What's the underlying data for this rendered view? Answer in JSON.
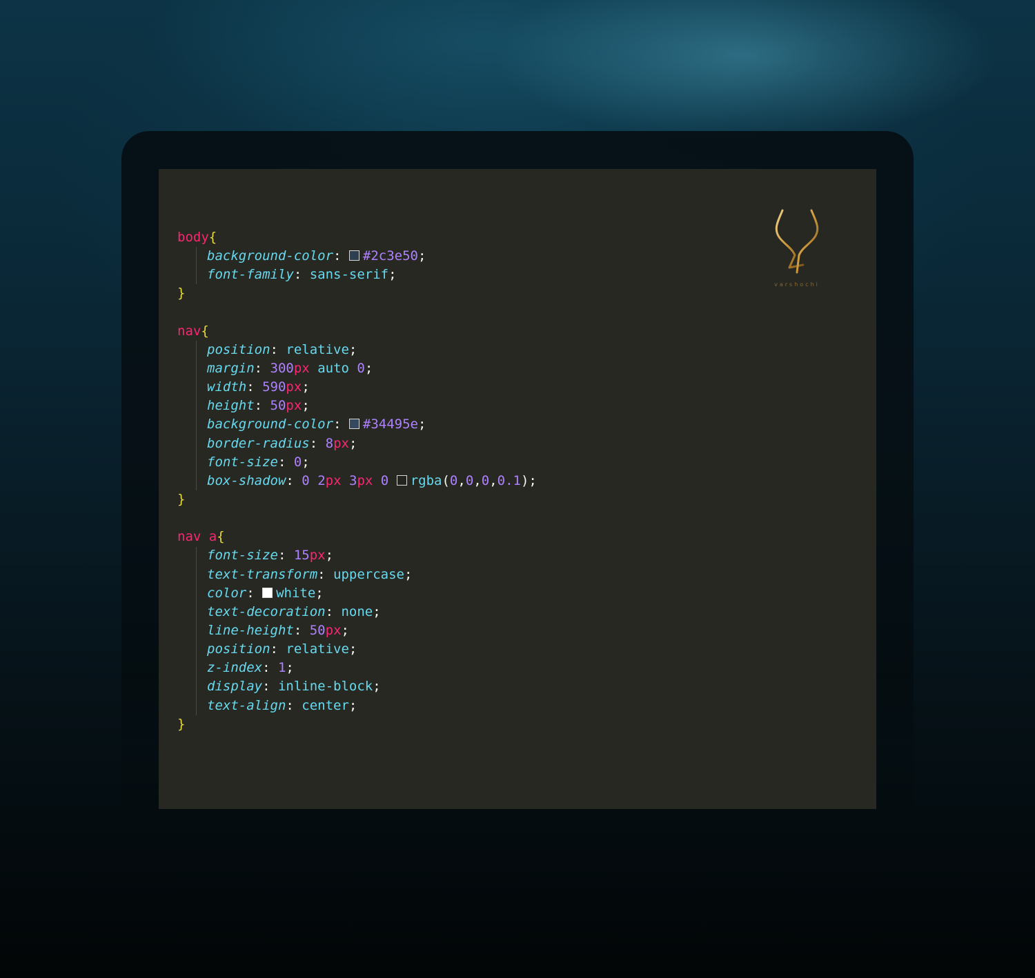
{
  "brand": {
    "name": "varshochi",
    "gold": "#c9963a"
  },
  "code": {
    "rules": [
      {
        "selector": [
          "body"
        ],
        "decls": [
          {
            "prop": "background-color",
            "value": [
              {
                "t": "sw",
                "color": "#2c3e50"
              },
              {
                "t": "hex",
                "v": "#2c3e50"
              }
            ]
          },
          {
            "prop": "font-family",
            "value": [
              {
                "t": "val",
                "v": "sans-serif"
              }
            ]
          }
        ]
      },
      {
        "selector": [
          "nav"
        ],
        "decls": [
          {
            "prop": "position",
            "value": [
              {
                "t": "val",
                "v": "relative"
              }
            ]
          },
          {
            "prop": "margin",
            "value": [
              {
                "t": "num",
                "v": "300"
              },
              {
                "t": "unit",
                "v": "px"
              },
              {
                "t": "sp"
              },
              {
                "t": "val",
                "v": "auto"
              },
              {
                "t": "sp"
              },
              {
                "t": "num",
                "v": "0"
              }
            ]
          },
          {
            "prop": "width",
            "value": [
              {
                "t": "num",
                "v": "590"
              },
              {
                "t": "unit",
                "v": "px"
              }
            ]
          },
          {
            "prop": "height",
            "value": [
              {
                "t": "num",
                "v": "50"
              },
              {
                "t": "unit",
                "v": "px"
              }
            ]
          },
          {
            "prop": "background-color",
            "value": [
              {
                "t": "sw",
                "color": "#34495e"
              },
              {
                "t": "hex",
                "v": "#34495e"
              }
            ]
          },
          {
            "prop": "border-radius",
            "value": [
              {
                "t": "num",
                "v": "8"
              },
              {
                "t": "unit",
                "v": "px"
              }
            ]
          },
          {
            "prop": "font-size",
            "value": [
              {
                "t": "num",
                "v": "0"
              }
            ]
          },
          {
            "prop": "box-shadow",
            "value": [
              {
                "t": "num",
                "v": "0"
              },
              {
                "t": "sp"
              },
              {
                "t": "num",
                "v": "2"
              },
              {
                "t": "unit",
                "v": "px"
              },
              {
                "t": "sp"
              },
              {
                "t": "num",
                "v": "3"
              },
              {
                "t": "unit",
                "v": "px"
              },
              {
                "t": "sp"
              },
              {
                "t": "num",
                "v": "0"
              },
              {
                "t": "sp"
              },
              {
                "t": "sw",
                "color": "rgba(0,0,0,0.1)"
              },
              {
                "t": "val",
                "v": "rgba"
              },
              {
                "t": "punc",
                "v": "("
              },
              {
                "t": "num",
                "v": "0"
              },
              {
                "t": "punc",
                "v": ","
              },
              {
                "t": "num",
                "v": "0"
              },
              {
                "t": "punc",
                "v": ","
              },
              {
                "t": "num",
                "v": "0"
              },
              {
                "t": "punc",
                "v": ","
              },
              {
                "t": "num",
                "v": "0.1"
              },
              {
                "t": "punc",
                "v": ")"
              }
            ]
          }
        ]
      },
      {
        "selector": [
          "nav",
          "a"
        ],
        "decls": [
          {
            "prop": "font-size",
            "value": [
              {
                "t": "num",
                "v": "15"
              },
              {
                "t": "unit",
                "v": "px"
              }
            ]
          },
          {
            "prop": "text-transform",
            "value": [
              {
                "t": "val",
                "v": "uppercase"
              }
            ]
          },
          {
            "prop": "color",
            "value": [
              {
                "t": "sw",
                "color": "#ffffff"
              },
              {
                "t": "val",
                "v": "white"
              }
            ]
          },
          {
            "prop": "text-decoration",
            "value": [
              {
                "t": "val",
                "v": "none"
              }
            ]
          },
          {
            "prop": "line-height",
            "value": [
              {
                "t": "num",
                "v": "50"
              },
              {
                "t": "unit",
                "v": "px"
              }
            ]
          },
          {
            "prop": "position",
            "value": [
              {
                "t": "val",
                "v": "relative"
              }
            ]
          },
          {
            "prop": "z-index",
            "value": [
              {
                "t": "num",
                "v": "1"
              }
            ]
          },
          {
            "prop": "display",
            "value": [
              {
                "t": "val",
                "v": "inline-block"
              }
            ]
          },
          {
            "prop": "text-align",
            "value": [
              {
                "t": "val",
                "v": "center"
              }
            ]
          }
        ]
      }
    ]
  }
}
